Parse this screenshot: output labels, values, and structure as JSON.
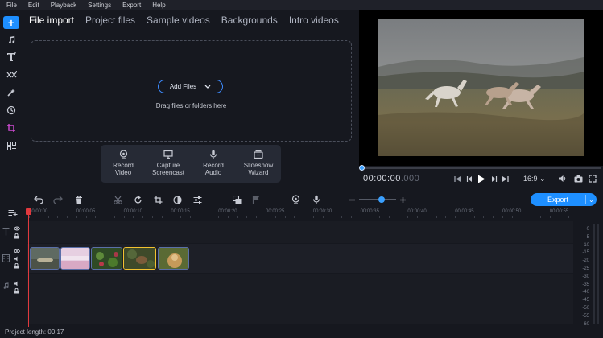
{
  "menu": [
    "File",
    "Edit",
    "Playback",
    "Settings",
    "Export",
    "Help"
  ],
  "sidebar": {
    "items": [
      {
        "icon": "plus-icon"
      },
      {
        "icon": "music-note-icon"
      },
      {
        "icon": "text-icon"
      },
      {
        "icon": "transitions-icon"
      },
      {
        "icon": "magic-wand-icon"
      },
      {
        "icon": "stickers-icon"
      },
      {
        "icon": "crop-icon"
      },
      {
        "icon": "more-tools-icon"
      }
    ]
  },
  "tabs": [
    "File import",
    "Project files",
    "Sample videos",
    "Backgrounds",
    "Intro videos"
  ],
  "import": {
    "add_files_label": "Add Files",
    "drag_text": "Drag files or folders here"
  },
  "capture": [
    {
      "line1": "Record",
      "line2": "Video",
      "icon": "webcam-icon"
    },
    {
      "line1": "Capture",
      "line2": "Screencast",
      "icon": "monitor-icon"
    },
    {
      "line1": "Record",
      "line2": "Audio",
      "icon": "microphone-icon"
    },
    {
      "line1": "Slideshow",
      "line2": "Wizard",
      "icon": "slideshow-icon"
    }
  ],
  "player": {
    "timecode": "00:00:00",
    "timecode_ms": ".000",
    "aspect": "16:9",
    "progress": 0
  },
  "timeline_toolbar": {
    "export_label": "Export"
  },
  "ruler": [
    "00:00:00",
    "00:00:05",
    "00:00:10",
    "00:00:15",
    "00:00:20",
    "00:00:25",
    "00:00:30",
    "00:00:35",
    "00:00:40",
    "00:00:45",
    "00:00:50",
    "00:00:55"
  ],
  "meter_labels": [
    "0",
    "-5",
    "-10",
    "-15",
    "-20",
    "-25",
    "-30",
    "-35",
    "-40",
    "-45",
    "-50",
    "-55",
    "-60"
  ],
  "status": {
    "project_length": "Project length: 00:17"
  },
  "colors": {
    "accent": "#1e8fff",
    "playhead": "#e0393e",
    "selected_clip": "#f2c230"
  }
}
